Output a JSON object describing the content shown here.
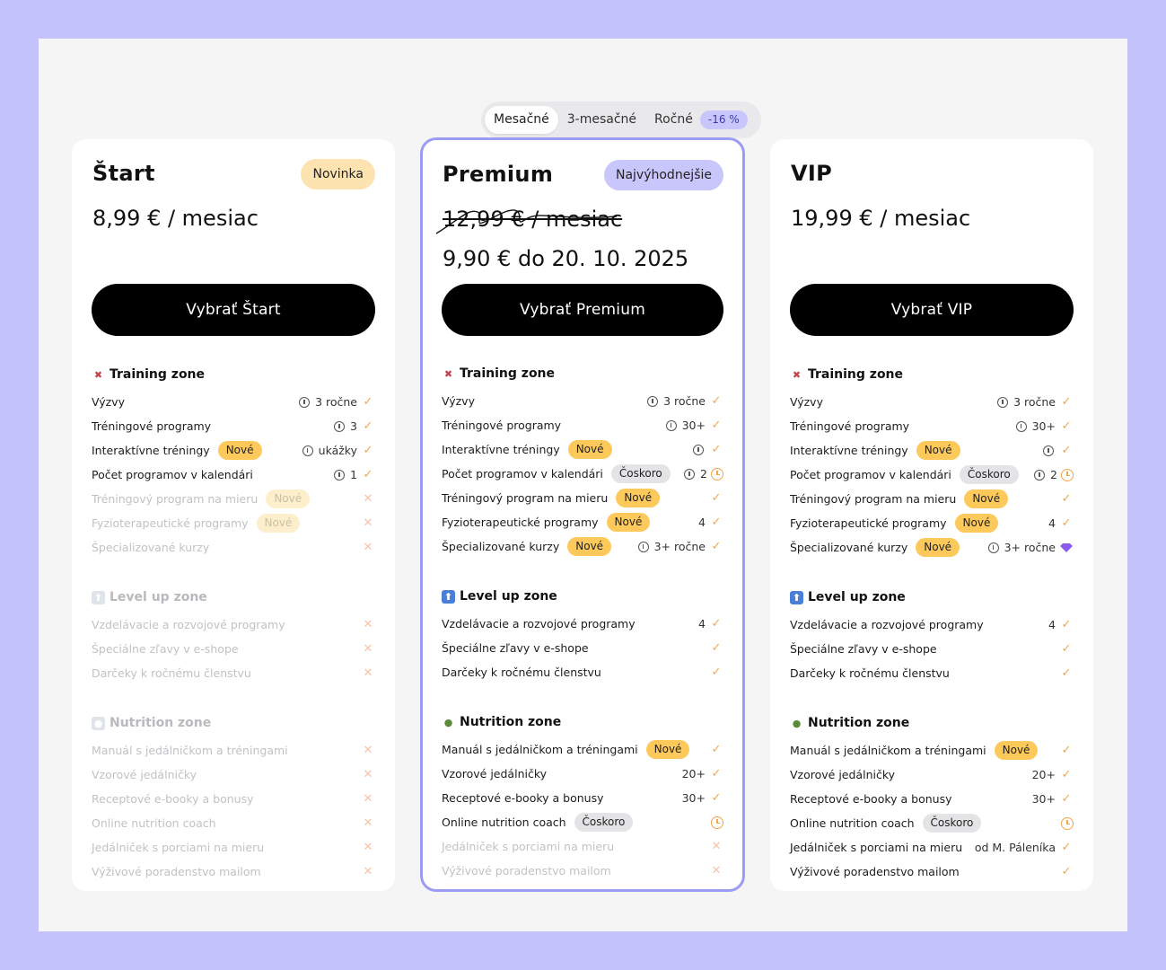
{
  "toggle": {
    "monthly": "Mesačné",
    "quarterly": "3-mesačné",
    "annual": "Ročné",
    "discount": "-16 %"
  },
  "plans": [
    {
      "name": "Štart",
      "badge": "Novinka",
      "price": "8,99 € / mesiac",
      "cta": "Vybrať Štart",
      "zones": [
        {
          "title": "Training zone",
          "rows": [
            {
              "label": "Výzvy",
              "value": "3 ročne"
            },
            {
              "label": "Tréningové programy",
              "value": "3"
            },
            {
              "label": "Interaktívne tréningy",
              "tag": "Nové",
              "value": "ukážky"
            },
            {
              "label": "Počet programov v kalendári",
              "value": "1"
            },
            {
              "label": "Tréningový program na mieru",
              "tag": "Nové"
            },
            {
              "label": "Fyzioterapeutické programy",
              "tag": "Nové"
            },
            {
              "label": "Špecializované kurzy"
            }
          ]
        },
        {
          "title": "Level up zone",
          "rows": [
            {
              "label": "Vzdelávacie a rozvojové programy"
            },
            {
              "label": "Špeciálne zľavy v e-shope"
            },
            {
              "label": "Darčeky k ročnému členstvu"
            }
          ]
        },
        {
          "title": "Nutrition zone",
          "rows": [
            {
              "label": "Manuál s jedálničkom a tréningami"
            },
            {
              "label": "Vzorové jedálničky"
            },
            {
              "label": "Receptové e-booky a bonusy"
            },
            {
              "label": "Online nutrition coach"
            },
            {
              "label": "Jedálniček s porciami na mieru"
            },
            {
              "label": "Výživové poradenstvo mailom"
            }
          ]
        }
      ]
    },
    {
      "name": "Premium",
      "badge": "Najvýhodnejšie",
      "old_price": "12,99 € / mesiac",
      "promo_price": "9,90 € do 20. 10. 2025",
      "cta": "Vybrať Premium",
      "zones": [
        {
          "title": "Training zone",
          "rows": [
            {
              "label": "Výzvy",
              "value": "3 ročne"
            },
            {
              "label": "Tréningové programy",
              "value": "30+"
            },
            {
              "label": "Interaktívne tréningy",
              "tag": "Nové"
            },
            {
              "label": "Počet programov v kalendári",
              "tag": "Čoskoro",
              "value": "2"
            },
            {
              "label": "Tréningový program na mieru",
              "tag": "Nové"
            },
            {
              "label": "Fyzioterapeutické programy",
              "tag": "Nové",
              "value": "4"
            },
            {
              "label": "Špecializované kurzy",
              "tag": "Nové",
              "value": "3+ ročne"
            }
          ]
        },
        {
          "title": "Level up zone",
          "rows": [
            {
              "label": "Vzdelávacie a rozvojové programy",
              "value": "4"
            },
            {
              "label": "Špeciálne zľavy v e-shope"
            },
            {
              "label": "Darčeky k ročnému členstvu"
            }
          ]
        },
        {
          "title": "Nutrition zone",
          "rows": [
            {
              "label": "Manuál s jedálničkom a tréningami",
              "tag": "Nové"
            },
            {
              "label": "Vzorové jedálničky",
              "value": "20+"
            },
            {
              "label": "Receptové e-booky a bonusy",
              "value": "30+"
            },
            {
              "label": "Online nutrition coach",
              "tag": "Čoskoro"
            },
            {
              "label": "Jedálniček s porciami na mieru"
            },
            {
              "label": "Výživové poradenstvo mailom"
            }
          ]
        }
      ]
    },
    {
      "name": "VIP",
      "price": "19,99 € / mesiac",
      "cta": "Vybrať VIP",
      "zones": [
        {
          "title": "Training zone",
          "rows": [
            {
              "label": "Výzvy",
              "value": "3 ročne"
            },
            {
              "label": "Tréningové programy",
              "value": "30+"
            },
            {
              "label": "Interaktívne tréningy",
              "tag": "Nové"
            },
            {
              "label": "Počet programov v kalendári",
              "tag": "Čoskoro",
              "value": "2"
            },
            {
              "label": "Tréningový program na mieru",
              "tag": "Nové"
            },
            {
              "label": "Fyzioterapeutické programy",
              "tag": "Nové",
              "value": "4"
            },
            {
              "label": "Špecializované kurzy",
              "tag": "Nové",
              "value": "3+ ročne"
            }
          ]
        },
        {
          "title": "Level up zone",
          "rows": [
            {
              "label": "Vzdelávacie a rozvojové programy",
              "value": "4"
            },
            {
              "label": "Špeciálne zľavy v e-shope"
            },
            {
              "label": "Darčeky k ročnému členstvu"
            }
          ]
        },
        {
          "title": "Nutrition zone",
          "rows": [
            {
              "label": "Manuál s jedálničkom a tréningami",
              "tag": "Nové"
            },
            {
              "label": "Vzorové jedálničky",
              "value": "20+"
            },
            {
              "label": "Receptové e-booky a bonusy",
              "value": "30+"
            },
            {
              "label": "Online nutrition coach",
              "tag": "Čoskoro"
            },
            {
              "label": "Jedálniček s porciami na mieru",
              "value": "od M. Páleníka"
            },
            {
              "label": "Výživové poradenstvo mailom"
            }
          ]
        }
      ]
    }
  ],
  "colors": {
    "background": "#c3c2fb",
    "accent_purple": "#9d9cf5",
    "badge_yellow": "#fcc95a",
    "check_orange": "#f5a54a"
  }
}
